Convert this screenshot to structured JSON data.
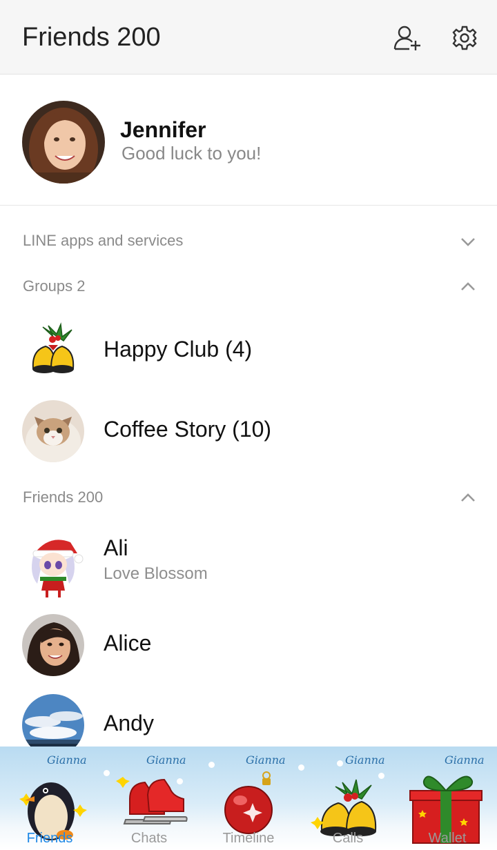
{
  "header": {
    "title": "Friends 200"
  },
  "profile": {
    "name": "Jennifer",
    "status": "Good luck to you!"
  },
  "sections": {
    "line_apps": "LINE apps and services",
    "groups": "Groups 2",
    "friends": "Friends 200"
  },
  "groups": [
    {
      "name": "Happy Club (4)",
      "avatar": "christmas-bells-icon"
    },
    {
      "name": "Coffee Story (10)",
      "avatar": "cat-photo"
    }
  ],
  "friends": [
    {
      "name": "Ali",
      "status": "Love Blossom",
      "avatar": "santa-girl-sticker"
    },
    {
      "name": "Alice",
      "status": "",
      "avatar": "woman-photo"
    },
    {
      "name": "Andy",
      "status": "",
      "avatar": "sky-photo"
    }
  ],
  "tabs": [
    {
      "label": "Friends",
      "active": true,
      "icon": "penguin-icon",
      "signature": "Gianna"
    },
    {
      "label": "Chats",
      "active": false,
      "icon": "ice-skates-icon",
      "signature": "Gianna"
    },
    {
      "label": "Timeline",
      "active": false,
      "icon": "ornament-icon",
      "signature": "Gianna"
    },
    {
      "label": "Calls",
      "active": false,
      "icon": "bells-icon",
      "signature": "Gianna"
    },
    {
      "label": "Wallet",
      "active": false,
      "icon": "gift-icon",
      "signature": "Gianna"
    }
  ],
  "colors": {
    "active_tab": "#1e88e5",
    "section_label": "#8a8a8a"
  }
}
